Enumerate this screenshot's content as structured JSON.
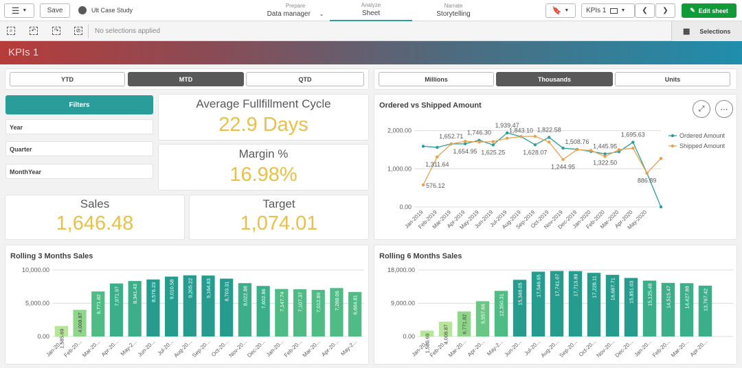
{
  "app": {
    "title": "Ult Case Study",
    "save_label": "Save"
  },
  "nav": {
    "prepare": {
      "small": "Prepare",
      "label": "Data manager"
    },
    "analyze": {
      "small": "Analyze",
      "label": "Sheet"
    },
    "narrate": {
      "small": "Narrate",
      "label": "Storytelling"
    }
  },
  "sheet_selector": "KPIs 1",
  "edit_label": "Edit sheet",
  "selections": {
    "status": "No selections applied",
    "label": "Selections"
  },
  "sheet_title": "KPIs 1",
  "period_buttons": [
    {
      "label": "YTD",
      "active": false
    },
    {
      "label": "MTD",
      "active": true
    },
    {
      "label": "QTD",
      "active": false
    }
  ],
  "unit_buttons": [
    {
      "label": "Millions",
      "active": false
    },
    {
      "label": "Thousands",
      "active": true
    },
    {
      "label": "Units",
      "active": false
    }
  ],
  "filters": {
    "header": "Filters",
    "items": [
      "Year",
      "Quarter",
      "MonthYear"
    ]
  },
  "kpis": {
    "fulfillment": {
      "title": "Average Fullfillment Cycle",
      "value": "22.9 Days"
    },
    "margin": {
      "title": "Margin %",
      "value": "16.98%"
    },
    "sales": {
      "title": "Sales",
      "value": "1,646.48"
    },
    "target": {
      "title": "Target",
      "value": "1,074.01"
    }
  },
  "colors": {
    "teal": "#2a9d9b",
    "orange": "#e8a24a",
    "kpi": "#e8c04a"
  },
  "chart_data": [
    {
      "type": "line",
      "title": "Ordered vs Shipped Amount",
      "x": [
        "Jan-2019",
        "Feb-2019",
        "Mar-2019",
        "Apr-2019",
        "May-2019",
        "Jun-2019",
        "Jul-2019",
        "Aug-2019",
        "Sep-2019",
        "Oct-2019",
        "Nov-2019",
        "Dec-2019",
        "Jan-2020",
        "Feb-2020",
        "Mar-2020",
        "Apr-2020",
        "May-2020",
        ""
      ],
      "series": [
        {
          "name": "Ordered Amount",
          "color": "#2a9d9b",
          "values": [
            1590,
            1560,
            1652.71,
            1654.95,
            1746.3,
            1625.25,
            1939.47,
            1843.1,
            1628.07,
            1822.58,
            1540,
            1508.76,
            1455,
            1390,
            1445.95,
            1695.63,
            886.89,
            0
          ]
        },
        {
          "name": "Shipped Amount",
          "color": "#e8a24a",
          "values": [
            576.12,
            1311.64,
            1650,
            1720,
            1700,
            1710,
            1800,
            1843.1,
            1850,
            1700,
            1244.95,
            1500,
            1480,
            1322.5,
            1500,
            1540,
            886.89,
            1270
          ]
        }
      ],
      "data_labels": [
        {
          "text": "1,652.71",
          "i": 2
        },
        {
          "text": "1,311.64",
          "i": 1
        },
        {
          "text": "576.12",
          "i": 0
        },
        {
          "text": "1,746.30",
          "i": 4
        },
        {
          "text": "1,654.95",
          "i": 3
        },
        {
          "text": "1,939.47",
          "i": 6
        },
        {
          "text": "1,625.25",
          "i": 5
        },
        {
          "text": "1,843.10",
          "i": 7
        },
        {
          "text": "1,628.07",
          "i": 8
        },
        {
          "text": "1,822.58",
          "i": 9
        },
        {
          "text": "1,244.95",
          "i": 10
        },
        {
          "text": "1,508.76",
          "i": 11
        },
        {
          "text": "1,445.95",
          "i": 13
        },
        {
          "text": "1,322.50",
          "i": 13
        },
        {
          "text": "1,695.63",
          "i": 15
        },
        {
          "text": "886.89",
          "i": 16
        }
      ],
      "yticks": [
        "0.00",
        "1,000.00",
        "2,000.00"
      ],
      "ylim": [
        0,
        2100
      ],
      "legend": "right",
      "grid": true
    },
    {
      "type": "bar",
      "title": "Rolling 3 Months Sales",
      "categories": [
        "Jan-20...",
        "Feb-20...",
        "Mar-20...",
        "Apr-20...",
        "May-2...",
        "Jun-20...",
        "Jul-20...",
        "Aug-20...",
        "Sep-20...",
        "Oct-20...",
        "Nov-20...",
        "Dec-20...",
        "Jan-20...",
        "Feb-20...",
        "Mar-20...",
        "Apr-20...",
        "May-2..."
      ],
      "values": [
        1585.69,
        4008.87,
        6771.82,
        7971.97,
        8341.43,
        8576.23,
        9010.58,
        9205.22,
        9164.83,
        8703.31,
        8022.88,
        7602.86,
        7147.74,
        7107.37,
        7012.89,
        7288.06,
        6684.81
      ],
      "labels": [
        "1,585.69",
        "4,008.87",
        "6,771.82",
        "7,971.97",
        "8,341.43",
        "8,576.23",
        "9,010.58",
        "9,205.22",
        "9,164.83",
        "8,703.31",
        "8,022.88",
        "7,602.86",
        "7,147.74",
        "7,107.37",
        "7,012.89",
        "7,288.06",
        "6,684.81"
      ],
      "yticks": [
        "0.00",
        "5,000.00",
        "10,000.00"
      ],
      "ylim": [
        0,
        10000
      ],
      "grid": true
    },
    {
      "type": "bar",
      "title": "Rolling 6 Months Sales",
      "categories": [
        "Jan-20...",
        "Feb-20...",
        "Mar-20...",
        "Apr-20...",
        "May-2...",
        "Jun-20...",
        "Jul-20...",
        "Aug-20...",
        "Sep-20...",
        "Oct-20...",
        "Nov-20...",
        "Dec-20...",
        "Jan-20...",
        "Feb-20...",
        "Mar-20...",
        "Apr-20...",
        "May-2..."
      ],
      "values": [
        1585.69,
        4008.87,
        6771.82,
        9557.66,
        12350.31,
        15348.05,
        17546.65,
        17741.07,
        17713.89,
        17228.11,
        16687.71,
        15851.03,
        15125.48,
        14515.47,
        14427.88,
        13767.42
      ],
      "labels": [
        "1,585.69",
        "4,008.87",
        "6,771.82",
        "9,557.66",
        "12,350.31",
        "15,348.05",
        "17,546.65",
        "17,741.07",
        "17,713.89",
        "17,228.11",
        "16,687.71",
        "15,851.03",
        "15,125.48",
        "14,515.47",
        "14,427.88",
        "13,767.42"
      ],
      "yticks": [
        "0.00",
        "9,000.00",
        "18,000.00"
      ],
      "ylim": [
        0,
        18000
      ],
      "grid": true
    }
  ]
}
